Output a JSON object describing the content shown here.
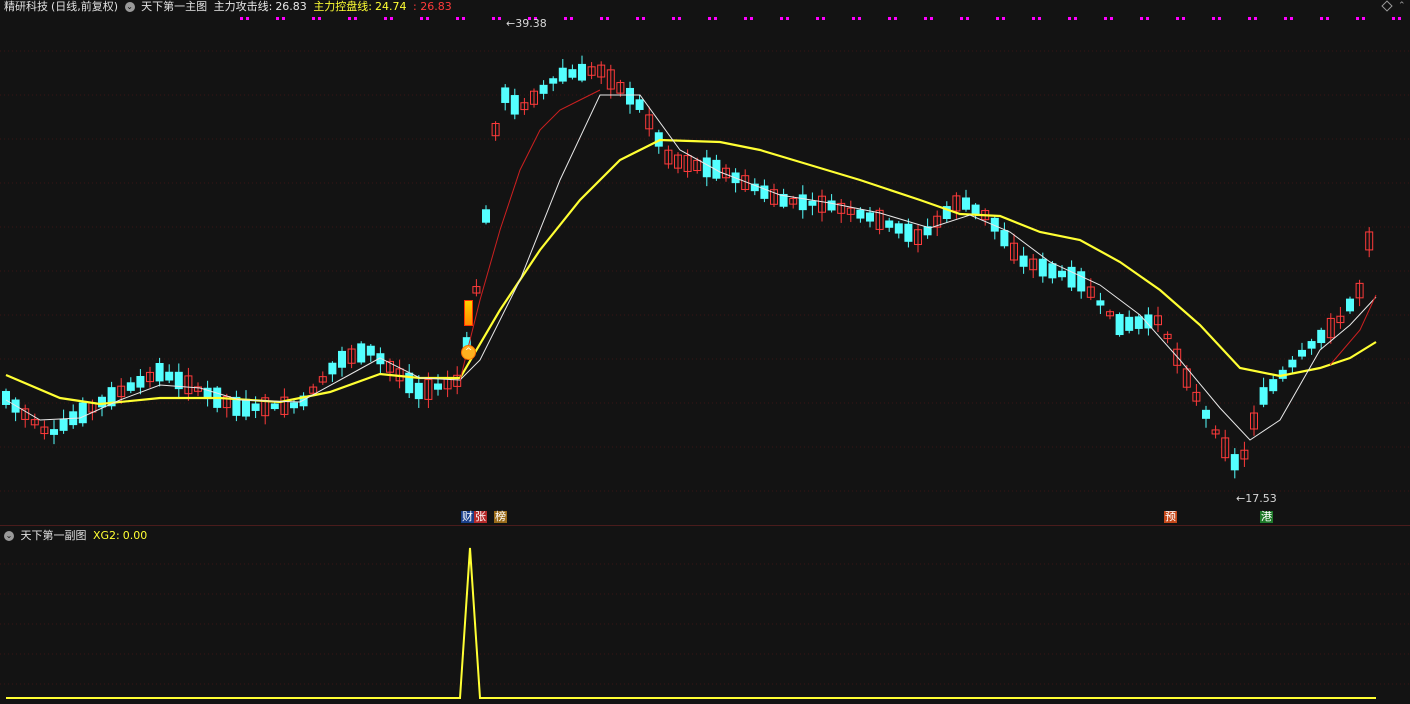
{
  "main": {
    "stock_name": "精研科技",
    "period": "(日线,前复权)",
    "indicator_name": "天下第一主图",
    "attack_label": "主力攻击线:",
    "attack_value": "26.83",
    "control_label": "主力控盘线:",
    "control_value": "24.74",
    "extra_value": "26.83",
    "high_label": "39.38",
    "low_label": "17.53",
    "markers": [
      "财",
      "张",
      "榜",
      "预",
      "港"
    ]
  },
  "sub": {
    "indicator_name": "天下第一副图",
    "xg_label": "XG2:",
    "xg_value": "0.00"
  },
  "colors": {
    "up": "#ff3b3b",
    "down": "#54ffff",
    "ma_slow": "#ffff33",
    "ma_fast_red": "#cc2020",
    "ma_fast_white": "#e8e8e8",
    "dot": "#ff00ff",
    "grid": "#3a1414"
  }
}
